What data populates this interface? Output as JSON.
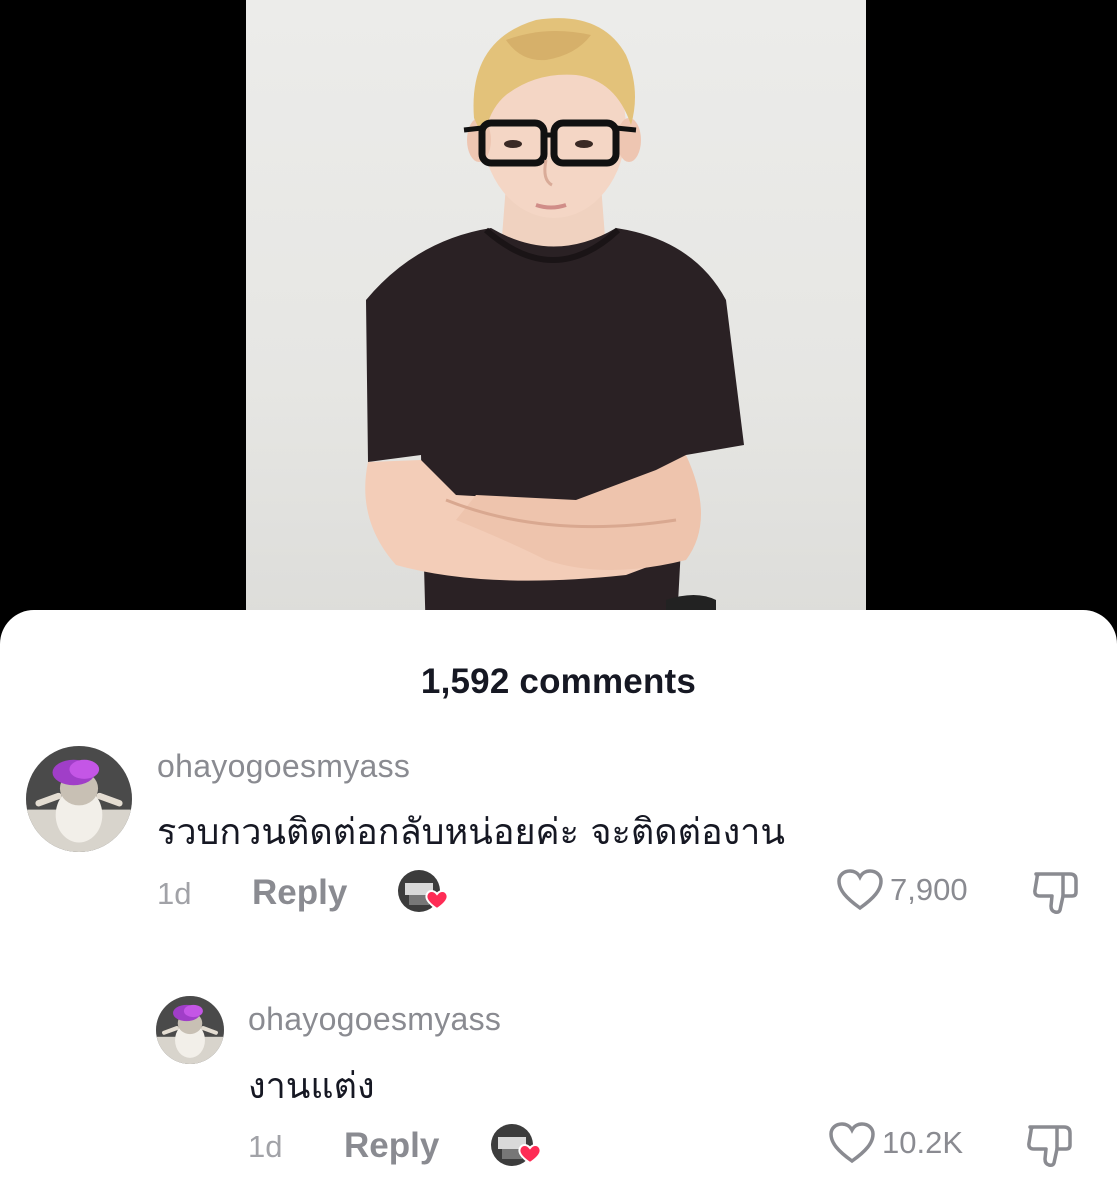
{
  "header": {
    "comments_count": "1,592 comments"
  },
  "comments": [
    {
      "username": "ohayogoesmyass",
      "text": "รวบกวนติดต่อกลับหน่อยค่ะ จะติดต่องาน",
      "time": "1d",
      "reply_label": "Reply",
      "likes": "7,900"
    },
    {
      "username": "ohayogoesmyass",
      "text": "งานแต่ง",
      "time": "1d",
      "reply_label": "Reply",
      "likes": "10.2K"
    }
  ],
  "icons": {
    "like": "heart-outline-icon",
    "dislike": "thumbs-down-icon",
    "creator_liked": "creator-liked-badge-icon"
  },
  "colors": {
    "background": "#000000",
    "sheet": "#ffffff",
    "primary_text": "#161823",
    "secondary_text": "#8a8b91",
    "heart_badge": "#fe2c55"
  }
}
